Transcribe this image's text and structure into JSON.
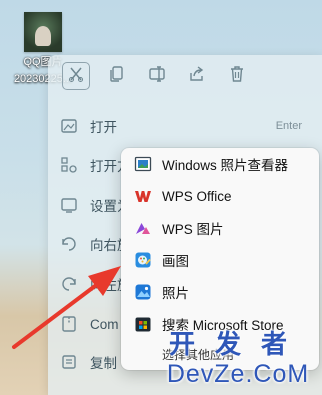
{
  "desktop": {
    "icon_label_line1": "QQ图片",
    "icon_label_line2": "20230225..."
  },
  "toolbar": {
    "buttons": [
      {
        "icon": "cut-icon"
      },
      {
        "icon": "copy-icon"
      },
      {
        "icon": "rename-icon"
      },
      {
        "icon": "share-icon"
      },
      {
        "icon": "delete-icon"
      }
    ]
  },
  "main_menu": {
    "items": [
      {
        "label": "打开",
        "shortcut": "Enter",
        "icon": "open-icon"
      },
      {
        "label": "打开方式",
        "icon": "open-with-icon"
      },
      {
        "label": "设置为",
        "icon": "wallpaper-icon"
      },
      {
        "label": "向右旋转",
        "icon": "rotate-icon"
      },
      {
        "label": "向左旋转",
        "icon": "rotate-left-icon"
      },
      {
        "label": "Com",
        "icon": "compress-icon"
      },
      {
        "label": "复制",
        "icon": "copy-path-icon"
      }
    ]
  },
  "submenu": {
    "items": [
      {
        "label": "Windows 照片查看器",
        "icon": "photo-viewer-icon"
      },
      {
        "label": "WPS Office",
        "icon": "wps-office-icon"
      },
      {
        "label": "WPS 图片",
        "icon": "wps-pictures-icon"
      },
      {
        "label": "画图",
        "icon": "paint-icon"
      },
      {
        "label": "照片",
        "icon": "photos-icon"
      },
      {
        "label": "搜索 Microsoft Store",
        "icon": "store-icon"
      },
      {
        "label": "选择其他应用"
      }
    ]
  },
  "watermark": {
    "top": "开发者",
    "bottom": "DevZe.CoM"
  },
  "colors": {
    "arrow": "#e8392c",
    "watermark": "#2f57b8",
    "wps_red": "#d9342b"
  }
}
